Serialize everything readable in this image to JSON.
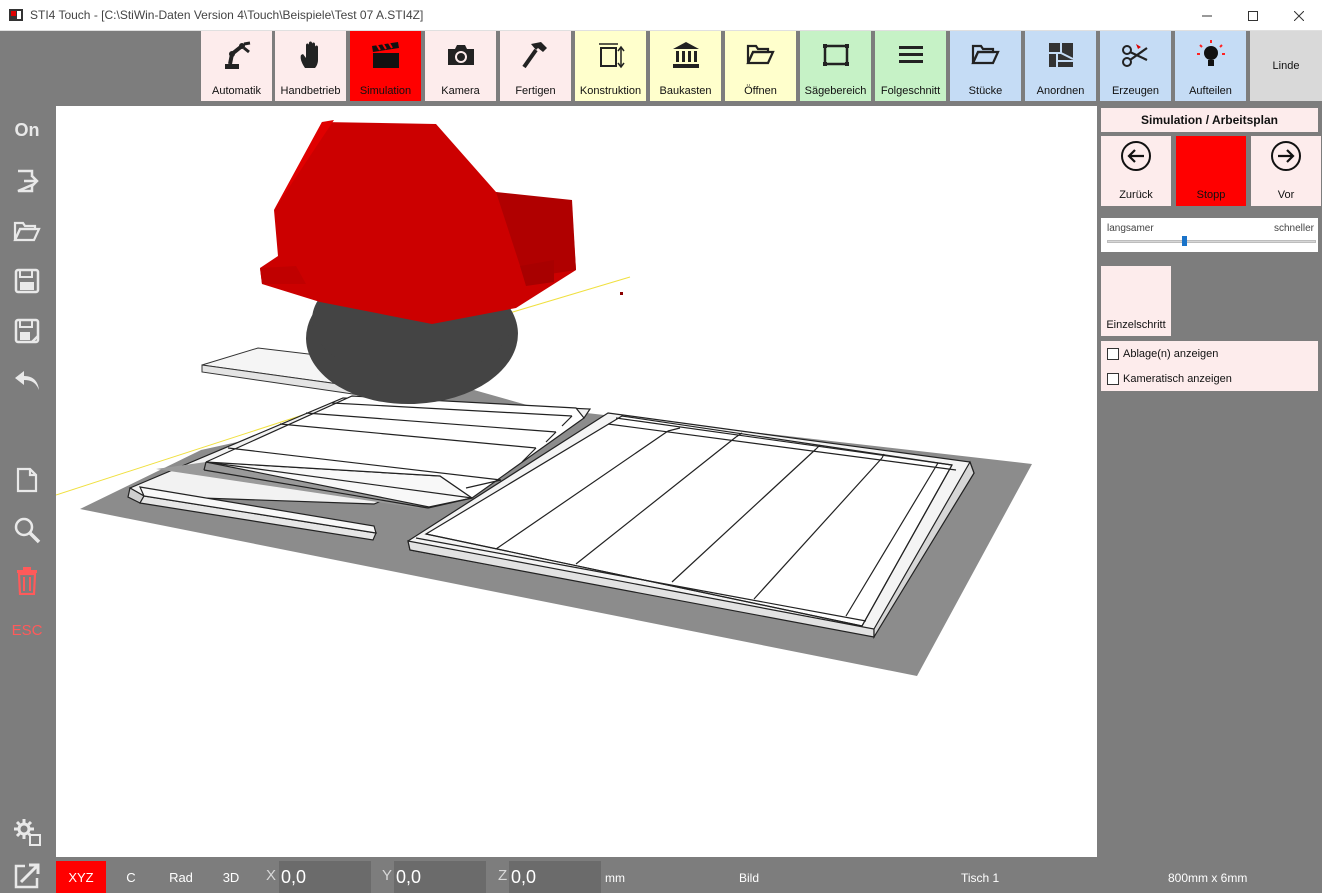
{
  "window": {
    "title": "STI4 Touch - [C:\\StiWin-Daten Version 4\\Touch\\Beispiele\\Test 07 A.STI4Z]"
  },
  "sidebar": {
    "on_label": "On",
    "esc_label": "ESC"
  },
  "toolbar": {
    "items": [
      {
        "label": "Automatik",
        "icon": "robot-arm-icon"
      },
      {
        "label": "Handbetrieb",
        "icon": "hand-icon"
      },
      {
        "label": "Simulation",
        "icon": "clapperboard-icon"
      },
      {
        "label": "Kamera",
        "icon": "camera-icon"
      },
      {
        "label": "Fertigen",
        "icon": "hammer-icon"
      },
      {
        "label": "Konstruktion",
        "icon": "construction-frame-icon"
      },
      {
        "label": "Baukasten",
        "icon": "building-icon"
      },
      {
        "label": "Öffnen",
        "icon": "folder-open-icon"
      },
      {
        "label": "Sägebereich",
        "icon": "saw-area-icon"
      },
      {
        "label": "Folgeschnitt",
        "icon": "menu-lines-icon"
      },
      {
        "label": "Stücke",
        "icon": "folder-icon"
      },
      {
        "label": "Anordnen",
        "icon": "arrange-grid-icon"
      },
      {
        "label": "Erzeugen",
        "icon": "scissors-icon"
      },
      {
        "label": "Aufteilen",
        "icon": "lightbulb-icon"
      },
      {
        "label": "Linde",
        "icon": ""
      }
    ]
  },
  "panel": {
    "title": "Simulation / Arbeitsplan",
    "back_label": "Zurück",
    "stop_label": "Stopp",
    "forward_label": "Vor",
    "speed_slow_label": "langsamer",
    "speed_fast_label": "schneller",
    "speed_level": 0.37,
    "single_step_label": "Einzelschritt",
    "checkbox_storage_label": "Ablage(n) anzeigen",
    "checkbox_camera_table_label": "Kameratisch anzeigen"
  },
  "statusbar": {
    "mode_xyz": "XYZ",
    "mode_c": "C",
    "mode_rad": "Rad",
    "mode_3d": "3D",
    "x_label": "X",
    "x_value": "0,0",
    "y_label": "Y",
    "y_value": "0,0",
    "z_label": "Z",
    "z_value": "0,0",
    "unit": "mm",
    "image_label": "Bild",
    "table_label": "Tisch 1",
    "dimension_label": "800mm x 6mm"
  },
  "colors": {
    "accent_red": "#ff0000",
    "pink": "#fdecec",
    "yellow": "#ffffcc",
    "green": "#c6f2c6",
    "blue": "#c5dcf5",
    "gray_bg": "#7d7d7d",
    "saw_red": "#cc0000",
    "blade_gray": "#444444"
  }
}
